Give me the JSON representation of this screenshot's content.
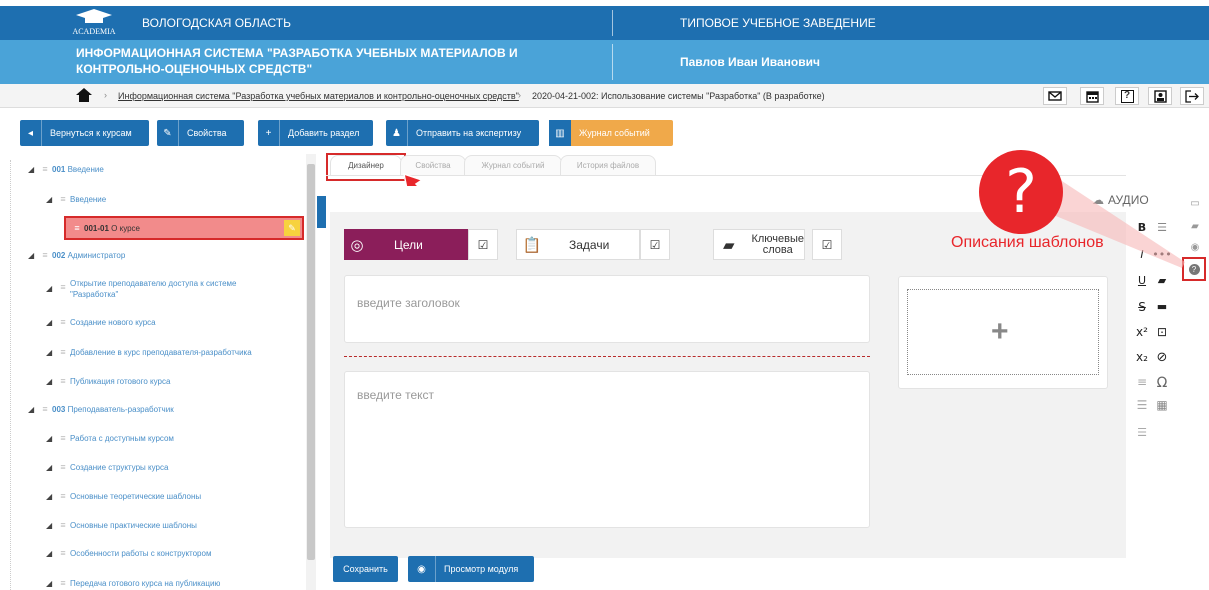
{
  "header": {
    "logo": "ACADEMIA",
    "region": "ВОЛОГОДСКАЯ ОБЛАСТЬ",
    "institution": "ТИПОВОЕ УЧЕБНОЕ ЗАВЕДЕНИЕ",
    "system_line1": "ИНФОРМАЦИОННАЯ СИСТЕМА \"РАЗРАБОТКА УЧЕБНЫХ МАТЕРИАЛОВ И",
    "system_line2": "КОНТРОЛЬНО-ОЦЕНОЧНЫХ СРЕДСТВ\"",
    "user": "Павлов Иван Иванович"
  },
  "breadcrumb": {
    "link": "Информационная система \"Разработка учебных материалов и контрольно-оценочных средств\"",
    "current": "2020-04-21-002: Использование системы \"Разработка\" (В разработке)"
  },
  "toolbar": {
    "back": "Вернуться к курсам",
    "properties": "Свойства",
    "add_section": "Добавить раздел",
    "send_review": "Отправить на экспертизу",
    "events_log": "Журнал событий"
  },
  "tree": [
    {
      "num": "001",
      "label": "Введение"
    },
    {
      "label": "Введение"
    },
    {
      "num": "001-01",
      "label": "О курсе"
    },
    {
      "num": "002",
      "label": "Администратор"
    },
    {
      "label": "Открытие преподавателю доступа к системе",
      "label2": "\"Разработка\""
    },
    {
      "label": "Создание нового курса"
    },
    {
      "label": "Добавление в курс преподавателя-разработчика"
    },
    {
      "label": "Публикация готового курса"
    },
    {
      "num": "003",
      "label": "Преподаватель-разработчик"
    },
    {
      "label": "Работа с доступным курсом"
    },
    {
      "label": "Создание структуры курса"
    },
    {
      "label": "Основные теоретические шаблоны"
    },
    {
      "label": "Основные практические шаблоны"
    },
    {
      "label": "Особенности работы с конструктором"
    },
    {
      "label": "Передача готового курса на публикацию"
    }
  ],
  "tabs": [
    "Дизайнер",
    "Свойства",
    "Журнал событий",
    "История файлов"
  ],
  "editor": {
    "audio": "АУДИО",
    "goals": "Цели",
    "tasks": "Задачи",
    "keywords_line1": "Ключевые",
    "keywords_line2": "слова",
    "title_placeholder": "введите заголовок",
    "text_placeholder": "введите текст",
    "plus": "+"
  },
  "annotation": {
    "text": "Описания шаблонов",
    "mark": "?"
  },
  "footer": {
    "save": "Сохранить",
    "preview": "Просмотр модуля"
  },
  "icons": {
    "home": "home-icon",
    "mail": "mail-icon",
    "calendar": "calendar-icon",
    "help": "help-icon",
    "profile": "profile-icon",
    "logout": "logout-icon"
  },
  "colors": {
    "primary": "#1e6fb0",
    "header2": "#4aa3d8",
    "accent": "#f0a94a",
    "goals": "#8b1e5a",
    "selected": "#f28b8b",
    "annotation": "#e8262b"
  }
}
